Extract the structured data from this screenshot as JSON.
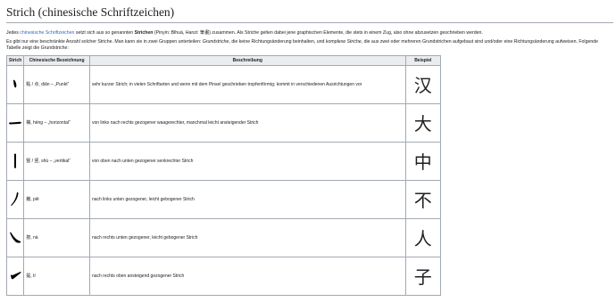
{
  "title": "Strich (chinesische Schriftzeichen)",
  "intro": {
    "part1": "Jedes ",
    "link": "chinesische Schriftzeichen",
    "part2": " setzt sich aus so genannten ",
    "bold": "Strichen",
    "part3": " (Pinyin: Bǐhuà, Hanzi: 筆畫) zusammen. Als Striche gelten dabei jene graphischen Elemente, die stets in einem Zug, also ohne abzusetzen geschrieben werden."
  },
  "para2": {
    "part1": "Es gibt nur eine beschränkte Anzahl solcher Striche. Man kann sie in zwei Gruppen unterteilen: ",
    "em1": "Grundstriche",
    "part2": ", die keine Richtungsänderung beinhalten, und ",
    "em2": "komplexe Striche",
    "part3": ", die aus zwei oder mehreren Grundstrichen aufgebaut sind und/oder eine Richtungsänderung aufweisen. Folgende Tabelle zeigt die Grundstriche:"
  },
  "table": {
    "headers": [
      "Strich",
      "Chinesische Bezeichnung",
      "Beschreibung",
      "Beispiel"
    ],
    "rows": [
      {
        "stroke_icon": "dian-stroke-icon",
        "name": "點 / 点, diǎn – „Punkt“",
        "desc": "sehr kurzer Strich; in vielen Schriftarten und wenn mit dem Pinsel geschrieben tropfenförmig; kommt in verschiedenen Ausrichtungen vor",
        "example": "汉"
      },
      {
        "stroke_icon": "heng-stroke-icon",
        "name": "橫, héng – „horizontal“",
        "desc": "von links nach rechts gezogener waagerechter, manchmal leicht ansteigender Strich",
        "example": "大"
      },
      {
        "stroke_icon": "shu-stroke-icon",
        "name": "豎 / 竖, shù – „vertikal“",
        "desc": "von oben nach unten gezogener senkrechter Strich",
        "example": "中"
      },
      {
        "stroke_icon": "pie-stroke-icon",
        "name": "撇, piě",
        "desc": "nach links unten gezogener, leicht gebogener Strich",
        "example": "不"
      },
      {
        "stroke_icon": "na-stroke-icon",
        "name": "捺, nà",
        "desc": "nach rechts unten gezogener, leicht gebogener Strich",
        "example": "人"
      },
      {
        "stroke_icon": "ti-stroke-icon",
        "name": "提, tí",
        "desc": "nach rechts oben ansteigend gezogener Strich",
        "example": "子"
      }
    ]
  }
}
